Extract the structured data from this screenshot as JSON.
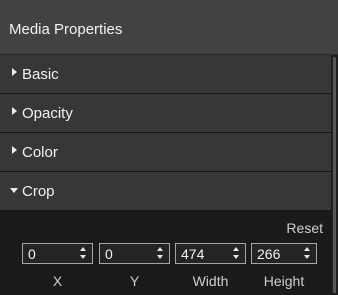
{
  "panel": {
    "title": "Media Properties"
  },
  "sections": [
    {
      "label": "Basic",
      "expanded": false
    },
    {
      "label": "Opacity",
      "expanded": false
    },
    {
      "label": "Color",
      "expanded": false
    },
    {
      "label": "Crop",
      "expanded": true
    }
  ],
  "crop": {
    "reset_label": "Reset",
    "fields": [
      {
        "label": "X",
        "value": "0"
      },
      {
        "label": "Y",
        "value": "0"
      },
      {
        "label": "Width",
        "value": "474"
      },
      {
        "label": "Height",
        "value": "266"
      }
    ]
  }
}
